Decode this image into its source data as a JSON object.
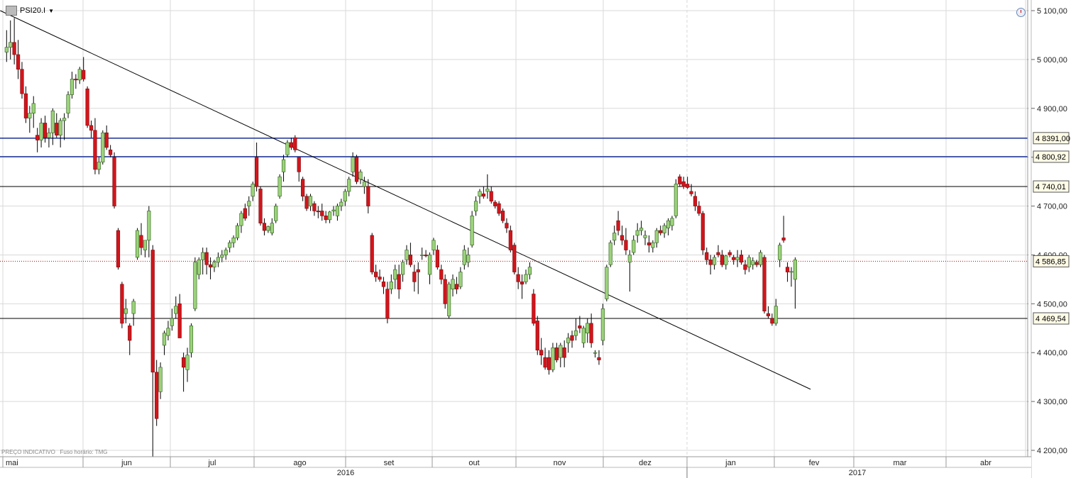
{
  "toolbar": {
    "symbol": "PSI20.I",
    "icon": "chart-settings-icon",
    "dropdown_icon": "caret-down-icon",
    "clock_icon": "clock-icon"
  },
  "footer_note": {
    "price_label": "PREÇO INDICATIVO",
    "tz_label": "Fuso horário: TMG"
  },
  "colors": {
    "up": "#9bd27a",
    "down": "#d4141b",
    "hline_blue": "#2a3f9b",
    "hline_black": "#000000",
    "current": "#c00000",
    "grid": "#d9d9d9"
  },
  "chart_data": {
    "type": "candlestick",
    "title": "",
    "ylim": [
      4140,
      5120
    ],
    "y_ticks": [
      "5 100,00",
      "5 000,00",
      "4 900,00",
      "4 800,00",
      "4 700,00",
      "4 600,00",
      "4 500,00",
      "4 400,00",
      "4 300,00",
      "4 200,00"
    ],
    "y_tick_values": [
      5100,
      5000,
      4900,
      4800,
      4700,
      4600,
      4500,
      4400,
      4300,
      4200
    ],
    "months": [
      "mai",
      "jun",
      "jul",
      "ago",
      "set",
      "out",
      "nov",
      "dez",
      "jan",
      "fev",
      "mar",
      "abr"
    ],
    "years": [
      "2016",
      "2017"
    ],
    "horizontal_levels": [
      {
        "label": "4 8391,00",
        "value": 4839,
        "style": "blue"
      },
      {
        "label": "4 800,92",
        "value": 4801,
        "style": "blue"
      },
      {
        "label": "4 740,01",
        "value": 4740,
        "style": "black"
      },
      {
        "label": "4 469,54",
        "value": 4470,
        "style": "black"
      }
    ],
    "current_price": {
      "label": "4 586,85",
      "value": 4587
    },
    "trendline": {
      "from": [
        0,
        5100
      ],
      "to": [
        209,
        4325
      ]
    },
    "candles": [
      [
        5015,
        5060,
        4995,
        5025
      ],
      [
        5025,
        5080,
        5000,
        5035
      ],
      [
        5035,
        5085,
        4990,
        5010
      ],
      [
        5010,
        5040,
        4960,
        4980
      ],
      [
        4980,
        4995,
        4920,
        4930
      ],
      [
        4930,
        4945,
        4870,
        4880
      ],
      [
        4880,
        4905,
        4850,
        4890
      ],
      [
        4890,
        4925,
        4860,
        4910
      ],
      [
        4845,
        4860,
        4810,
        4835
      ],
      [
        4835,
        4880,
        4820,
        4870
      ],
      [
        4870,
        4885,
        4830,
        4840
      ],
      [
        4840,
        4860,
        4820,
        4850
      ],
      [
        4850,
        4900,
        4825,
        4895
      ],
      [
        4870,
        4890,
        4840,
        4845
      ],
      [
        4845,
        4880,
        4820,
        4875
      ],
      [
        4875,
        4890,
        4835,
        4880
      ],
      [
        4890,
        4935,
        4880,
        4928
      ],
      [
        4928,
        4975,
        4920,
        4960
      ],
      [
        4960,
        4970,
        4940,
        4958
      ],
      [
        4958,
        4985,
        4950,
        4980
      ],
      [
        4978,
        5005,
        4955,
        4960
      ],
      [
        4940,
        4945,
        4860,
        4865
      ],
      [
        4865,
        4875,
        4840,
        4855
      ],
      [
        4855,
        4880,
        4765,
        4775
      ],
      [
        4775,
        4800,
        4765,
        4790
      ],
      [
        4790,
        4855,
        4785,
        4850
      ],
      [
        4850,
        4865,
        4815,
        4820
      ],
      [
        4815,
        4825,
        4800,
        4805
      ],
      [
        4800,
        4810,
        4695,
        4700
      ],
      [
        4650,
        4655,
        4570,
        4575
      ],
      [
        4540,
        4545,
        4450,
        4460
      ],
      [
        4480,
        4510,
        4460,
        4490
      ],
      [
        4455,
        4460,
        4395,
        4425
      ],
      [
        4480,
        4510,
        4455,
        4505
      ],
      [
        4595,
        4655,
        4590,
        4650
      ],
      [
        4640,
        4665,
        4600,
        4615
      ],
      [
        4610,
        4630,
        4595,
        4630
      ],
      [
        4630,
        4700,
        4595,
        4690
      ],
      [
        4610,
        4620,
        4170,
        4360
      ],
      [
        4360,
        4385,
        4250,
        4265
      ],
      [
        4320,
        4380,
        4305,
        4370
      ],
      [
        4415,
        4445,
        4395,
        4440
      ],
      [
        4435,
        4465,
        4425,
        4450
      ],
      [
        4455,
        4490,
        4445,
        4470
      ],
      [
        4480,
        4515,
        4470,
        4495
      ],
      [
        4500,
        4520,
        4430,
        4430
      ],
      [
        4390,
        4400,
        4320,
        4370
      ],
      [
        4365,
        4410,
        4340,
        4395
      ],
      [
        4400,
        4460,
        4390,
        4455
      ],
      [
        4490,
        4595,
        4485,
        4585
      ],
      [
        4560,
        4595,
        4550,
        4590
      ],
      [
        4590,
        4615,
        4560,
        4605
      ],
      [
        4605,
        4615,
        4560,
        4580
      ],
      [
        4580,
        4595,
        4550,
        4575
      ],
      [
        4575,
        4590,
        4565,
        4585
      ],
      [
        4585,
        4605,
        4575,
        4595
      ],
      [
        4595,
        4610,
        4585,
        4600
      ],
      [
        4600,
        4615,
        4590,
        4610
      ],
      [
        4615,
        4630,
        4605,
        4625
      ],
      [
        4625,
        4640,
        4615,
        4635
      ],
      [
        4635,
        4665,
        4630,
        4660
      ],
      [
        4660,
        4690,
        4645,
        4685
      ],
      [
        4695,
        4705,
        4670,
        4675
      ],
      [
        4700,
        4720,
        4680,
        4710
      ],
      [
        4720,
        4750,
        4710,
        4745
      ],
      [
        4800,
        4830,
        4730,
        4740
      ],
      [
        4735,
        4740,
        4660,
        4665
      ],
      [
        4665,
        4675,
        4640,
        4650
      ],
      [
        4650,
        4660,
        4645,
        4658
      ],
      [
        4645,
        4675,
        4640,
        4665
      ],
      [
        4670,
        4705,
        4665,
        4700
      ],
      [
        4720,
        4765,
        4715,
        4760
      ],
      [
        4770,
        4805,
        4750,
        4795
      ],
      [
        4805,
        4835,
        4800,
        4830
      ],
      [
        4830,
        4840,
        4815,
        4820
      ],
      [
        4840,
        4845,
        4810,
        4815
      ],
      [
        4800,
        4800,
        4750,
        4770
      ],
      [
        4755,
        4760,
        4710,
        4720
      ],
      [
        4720,
        4725,
        4690,
        4695
      ],
      [
        4700,
        4725,
        4690,
        4720
      ],
      [
        4705,
        4710,
        4680,
        4690
      ],
      [
        4690,
        4700,
        4675,
        4688
      ],
      [
        4690,
        4705,
        4670,
        4680
      ],
      [
        4680,
        4690,
        4665,
        4672
      ],
      [
        4672,
        4690,
        4665,
        4688
      ],
      [
        4690,
        4700,
        4680,
        4692
      ],
      [
        4680,
        4705,
        4670,
        4700
      ],
      [
        4700,
        4715,
        4690,
        4708
      ],
      [
        4710,
        4735,
        4700,
        4730
      ],
      [
        4730,
        4760,
        4720,
        4755
      ],
      [
        4770,
        4810,
        4760,
        4800
      ],
      [
        4800,
        4805,
        4745,
        4750
      ],
      [
        4755,
        4775,
        4745,
        4770
      ],
      [
        4740,
        4760,
        4725,
        4750
      ],
      [
        4740,
        4755,
        4685,
        4700
      ],
      [
        4640,
        4645,
        4560,
        4565
      ],
      [
        4565,
        4580,
        4545,
        4555
      ],
      [
        4555,
        4570,
        4545,
        4550
      ],
      [
        4545,
        4555,
        4520,
        4535
      ],
      [
        4530,
        4545,
        4460,
        4470
      ],
      [
        4530,
        4560,
        4520,
        4545
      ],
      [
        4550,
        4580,
        4530,
        4570
      ],
      [
        4560,
        4580,
        4510,
        4530
      ],
      [
        4560,
        4590,
        4545,
        4585
      ],
      [
        4590,
        4620,
        4580,
        4610
      ],
      [
        4600,
        4625,
        4575,
        4580
      ],
      [
        4565,
        4580,
        4525,
        4545
      ],
      [
        4570,
        4585,
        4520,
        4565
      ],
      [
        4600,
        4615,
        4590,
        4600
      ],
      [
        4600,
        4610,
        4595,
        4598
      ],
      [
        4560,
        4605,
        4540,
        4600
      ],
      [
        4610,
        4635,
        4600,
        4630
      ],
      [
        4610,
        4620,
        4570,
        4575
      ],
      [
        4570,
        4580,
        4540,
        4550
      ],
      [
        4550,
        4560,
        4490,
        4500
      ],
      [
        4475,
        4545,
        4470,
        4540
      ],
      [
        4530,
        4560,
        4515,
        4550
      ],
      [
        4540,
        4555,
        4520,
        4530
      ],
      [
        4535,
        4575,
        4530,
        4565
      ],
      [
        4580,
        4620,
        4570,
        4610
      ],
      [
        4585,
        4615,
        4575,
        4600
      ],
      [
        4620,
        4690,
        4615,
        4680
      ],
      [
        4690,
        4720,
        4680,
        4710
      ],
      [
        4720,
        4735,
        4705,
        4730
      ],
      [
        4725,
        4740,
        4715,
        4720
      ],
      [
        4730,
        4765,
        4715,
        4735
      ],
      [
        4730,
        4740,
        4705,
        4710
      ],
      [
        4708,
        4712,
        4695,
        4700
      ],
      [
        4705,
        4710,
        4680,
        4685
      ],
      [
        4690,
        4695,
        4665,
        4670
      ],
      [
        4665,
        4675,
        4645,
        4655
      ],
      [
        4650,
        4660,
        4605,
        4610
      ],
      [
        4620,
        4625,
        4560,
        4565
      ],
      [
        4560,
        4575,
        4530,
        4545
      ],
      [
        4545,
        4560,
        4510,
        4540
      ],
      [
        4545,
        4570,
        4540,
        4560
      ],
      [
        4560,
        4585,
        4550,
        4575
      ],
      [
        4520,
        4530,
        4455,
        4460
      ],
      [
        4465,
        4475,
        4395,
        4405
      ],
      [
        4405,
        4430,
        4375,
        4395
      ],
      [
        4390,
        4410,
        4365,
        4370
      ],
      [
        4390,
        4405,
        4355,
        4365
      ],
      [
        4365,
        4420,
        4360,
        4410
      ],
      [
        4410,
        4420,
        4380,
        4385
      ],
      [
        4390,
        4420,
        4370,
        4415
      ],
      [
        4410,
        4425,
        4370,
        4390
      ],
      [
        4420,
        4440,
        4400,
        4430
      ],
      [
        4435,
        4445,
        4410,
        4425
      ],
      [
        4435,
        4470,
        4425,
        4445
      ],
      [
        4455,
        4475,
        4440,
        4450
      ],
      [
        4420,
        4455,
        4410,
        4450
      ],
      [
        4440,
        4470,
        4420,
        4460
      ],
      [
        4460,
        4480,
        4410,
        4420
      ],
      [
        4400,
        4405,
        4390,
        4400
      ],
      [
        4390,
        4405,
        4375,
        4385
      ],
      [
        4425,
        4500,
        4415,
        4490
      ],
      [
        4510,
        4580,
        4505,
        4575
      ],
      [
        4580,
        4630,
        4575,
        4625
      ],
      [
        4630,
        4660,
        4620,
        4645
      ],
      [
        4670,
        4690,
        4640,
        4650
      ],
      [
        4640,
        4660,
        4620,
        4630
      ],
      [
        4630,
        4655,
        4600,
        4610
      ],
      [
        4585,
        4610,
        4525,
        4600
      ],
      [
        4605,
        4640,
        4600,
        4630
      ],
      [
        4640,
        4665,
        4625,
        4650
      ],
      [
        4650,
        4670,
        4640,
        4655
      ],
      [
        4635,
        4650,
        4620,
        4640
      ],
      [
        4625,
        4640,
        4605,
        4620
      ],
      [
        4615,
        4630,
        4605,
        4625
      ],
      [
        4625,
        4655,
        4615,
        4650
      ],
      [
        4650,
        4660,
        4640,
        4645
      ],
      [
        4645,
        4665,
        4635,
        4660
      ],
      [
        4655,
        4675,
        4640,
        4670
      ],
      [
        4660,
        4680,
        4650,
        4675
      ],
      [
        4680,
        4755,
        4675,
        4745
      ],
      [
        4760,
        4765,
        4740,
        4745
      ],
      [
        4750,
        4760,
        4735,
        4740
      ],
      [
        4745,
        4760,
        4735,
        4738
      ],
      [
        4730,
        4745,
        4720,
        4725
      ],
      [
        4720,
        4730,
        4690,
        4700
      ],
      [
        4700,
        4710,
        4680,
        4685
      ],
      [
        4685,
        4690,
        4600,
        4610
      ],
      [
        4605,
        4615,
        4580,
        4590
      ],
      [
        4590,
        4600,
        4560,
        4580
      ],
      [
        4580,
        4600,
        4570,
        4595
      ],
      [
        4605,
        4620,
        4595,
        4600
      ],
      [
        4600,
        4610,
        4575,
        4580
      ],
      [
        4580,
        4600,
        4570,
        4598
      ],
      [
        4605,
        4610,
        4595,
        4600
      ],
      [
        4595,
        4600,
        4580,
        4590
      ],
      [
        4590,
        4610,
        4575,
        4595
      ],
      [
        4600,
        4610,
        4580,
        4585
      ],
      [
        4580,
        4590,
        4560,
        4570
      ],
      [
        4575,
        4600,
        4565,
        4595
      ],
      [
        4580,
        4595,
        4570,
        4588
      ],
      [
        4585,
        4590,
        4575,
        4580
      ],
      [
        4580,
        4610,
        4575,
        4605
      ],
      [
        4595,
        4600,
        4480,
        4485
      ],
      [
        4480,
        4495,
        4470,
        4475
      ],
      [
        4470,
        4480,
        4455,
        4460
      ],
      [
        4460,
        4510,
        4455,
        4495
      ],
      [
        4590,
        4625,
        4575,
        4620
      ],
      [
        4635,
        4680,
        4625,
        4630
      ],
      [
        4575,
        4585,
        4545,
        4565
      ],
      [
        4565,
        4575,
        4535,
        4566
      ],
      [
        4550,
        4595,
        4490,
        4590
      ]
    ]
  }
}
